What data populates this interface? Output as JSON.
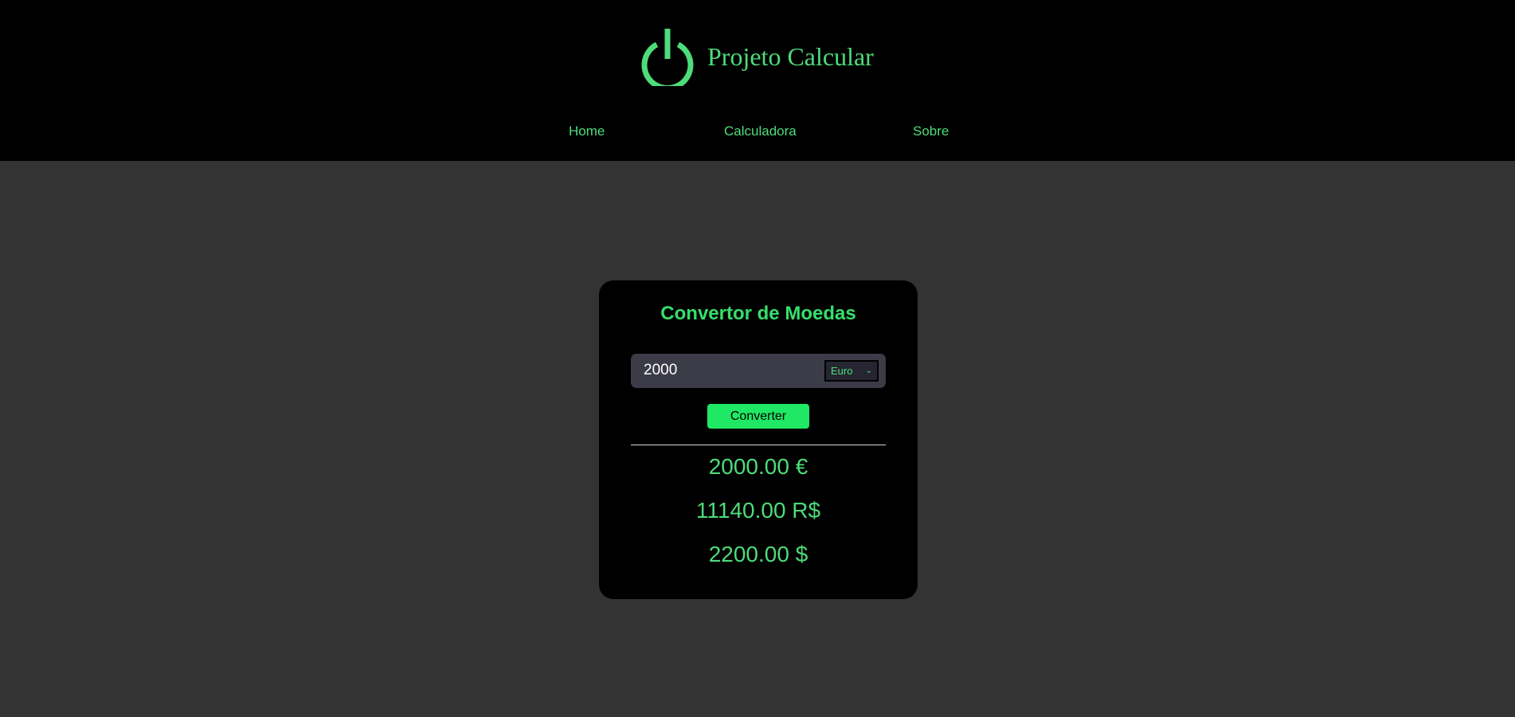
{
  "header": {
    "title": "Projeto Calcular",
    "logo_icon": "power-icon",
    "accent_color": "#4ddc79"
  },
  "nav": {
    "items": [
      {
        "label": "Home"
      },
      {
        "label": "Calculadora"
      },
      {
        "label": "Sobre"
      }
    ]
  },
  "converter": {
    "title": "Convertor de Moedas",
    "amount_value": "2000",
    "currency_selected": "Euro",
    "button_label": "Converter",
    "results": [
      "2000.00 €",
      "11140.00 R$",
      "2200.00 $"
    ]
  },
  "colors": {
    "page_background": "#333333",
    "header_background": "#000000",
    "card_background": "#000000",
    "title_green": "#34e06b",
    "button_green": "#1fe864"
  }
}
